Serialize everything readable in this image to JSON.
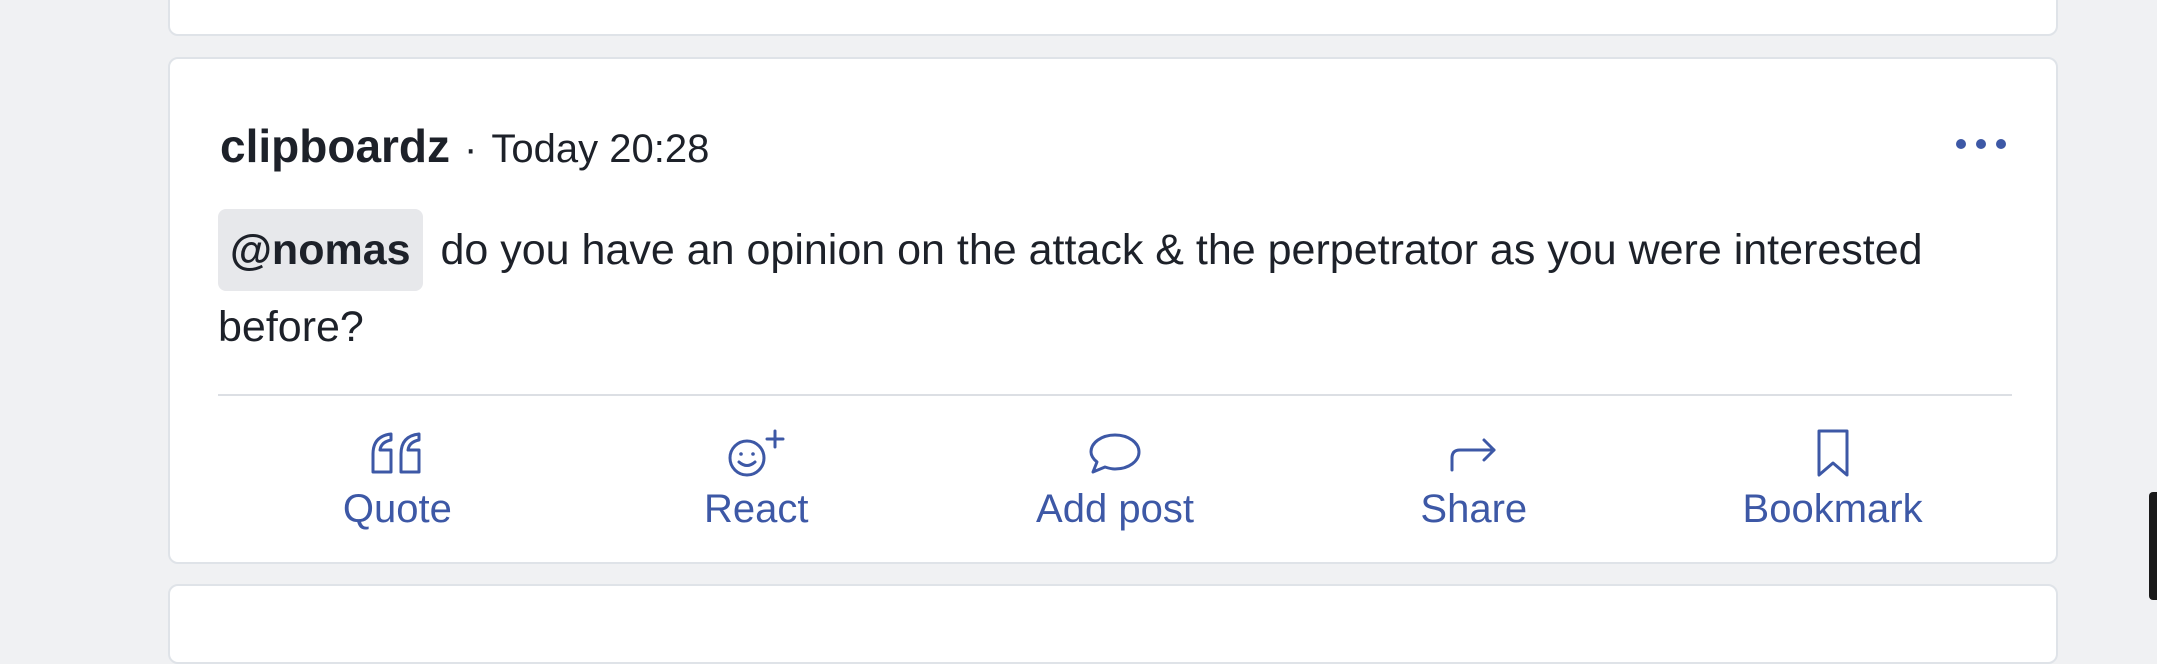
{
  "post": {
    "author": "clipboardz",
    "separator": "·",
    "timestamp": "Today 20:28",
    "more_icon": "ellipsis-icon",
    "body": {
      "mention": "@nomas",
      "text": "do you have an opinion on the attack & the perpetrator as you were interested before?"
    },
    "actions": [
      {
        "label": "Quote",
        "icon": "quote-icon"
      },
      {
        "label": "React",
        "icon": "react-icon"
      },
      {
        "label": "Add post",
        "icon": "comment-icon"
      },
      {
        "label": "Share",
        "icon": "share-icon"
      },
      {
        "label": "Bookmark",
        "icon": "bookmark-icon"
      }
    ]
  },
  "colors": {
    "background": "#f0f1f3",
    "card": "#ffffff",
    "text": "#1d2129",
    "accent": "#3d58a6",
    "mention_bg": "#e7e8eb"
  }
}
